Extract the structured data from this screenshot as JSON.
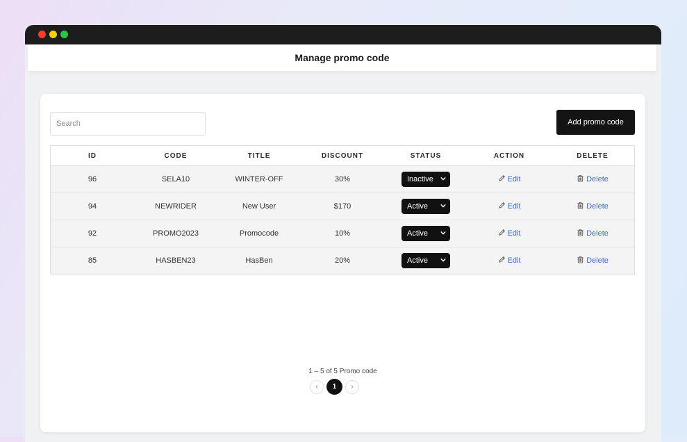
{
  "header": {
    "title": "Manage promo code"
  },
  "toolbar": {
    "search_placeholder": "Search",
    "add_label": "Add promo code"
  },
  "table": {
    "columns": [
      "ID",
      "CODE",
      "TITLE",
      "DISCOUNT",
      "STATUS",
      "ACTION",
      "DELETE"
    ],
    "rows": [
      {
        "id": "96",
        "code": "SELA10",
        "title": "WINTER-OFF",
        "discount": "30%",
        "status": "Inactive",
        "action": "Edit",
        "delete": "Delete"
      },
      {
        "id": "94",
        "code": "NEWRIDER",
        "title": "New User",
        "discount": "$170",
        "status": "Active",
        "action": "Edit",
        "delete": "Delete"
      },
      {
        "id": "92",
        "code": "PROMO2023",
        "title": "Promocode",
        "discount": "10%",
        "status": "Active",
        "action": "Edit",
        "delete": "Delete"
      },
      {
        "id": "85",
        "code": "HASBEN23",
        "title": "HasBen",
        "discount": "20%",
        "status": "Active",
        "action": "Edit",
        "delete": "Delete"
      }
    ]
  },
  "pagination": {
    "info": "1 – 5 of 5 Promo code",
    "prev": "‹",
    "current": "1",
    "next": "›"
  },
  "colors": {
    "accent": "#141414",
    "link": "#3b6fd4",
    "row_bg": "#f4f4f4"
  },
  "icons": {
    "edit": "pencil-icon",
    "delete": "trash-icon",
    "status": "chevron-down-icon"
  }
}
